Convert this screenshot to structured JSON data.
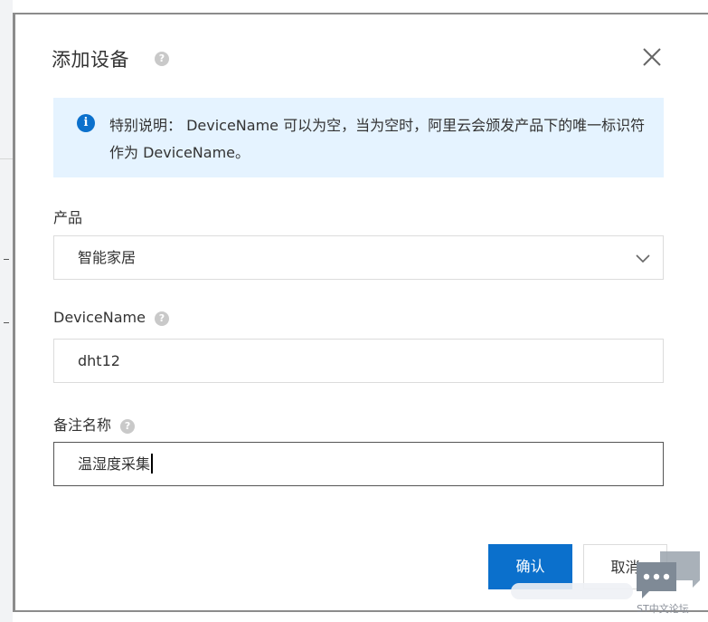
{
  "dialog": {
    "title": "添加设备",
    "title_help": "?"
  },
  "notice": {
    "icon": "i",
    "text": "特别说明： DeviceName 可以为空，当为空时，阿里云会颁发产品下的唯一标识符作为 DeviceName。"
  },
  "form": {
    "product": {
      "label": "产品",
      "value": "智能家居"
    },
    "device_name": {
      "label": "DeviceName",
      "help": "?",
      "value": "dht12"
    },
    "remark": {
      "label": "备注名称",
      "help": "?",
      "value": "温湿度采集"
    }
  },
  "actions": {
    "confirm_label": "确认",
    "cancel_label": "取消"
  },
  "watermark": {
    "text": "ST中文论坛"
  },
  "colors": {
    "primary": "#0b70cc",
    "notice_bg": "#e5f3ff",
    "border": "#dcdcdc",
    "help_icon": "#c9c9c9"
  }
}
